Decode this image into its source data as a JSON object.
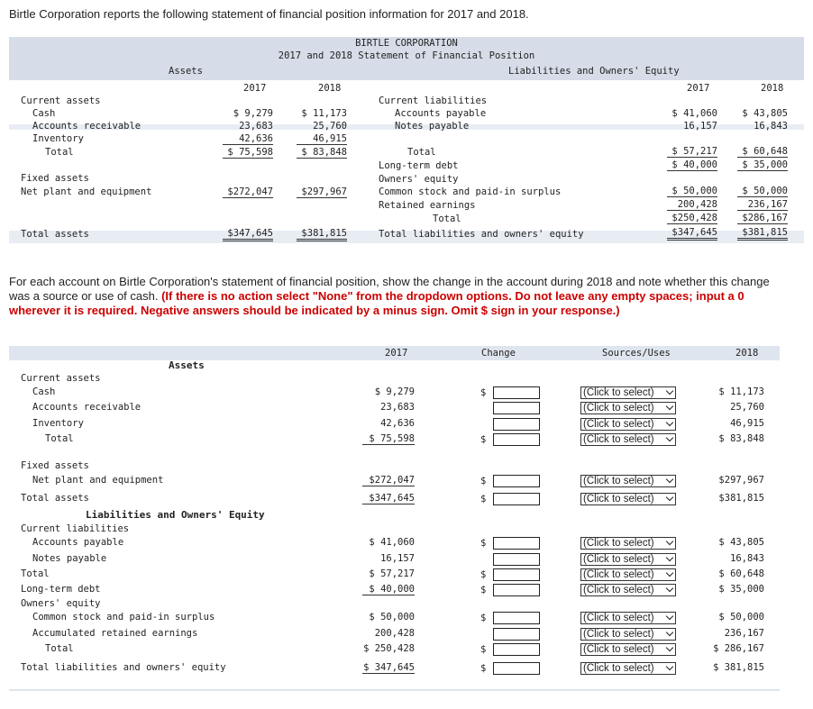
{
  "intro": "Birtle Corporation reports the following statement of financial position information for 2017 and 2018.",
  "bs": {
    "company": "BIRTLE CORPORATION",
    "subtitle": "2017 and 2018 Statement of Financial Position",
    "assets_header": "Assets",
    "le_header": "Liabilities and Owners' Equity",
    "y2017": "2017",
    "y2018": "2018",
    "left": [
      {
        "label": "Current assets",
        "a": "",
        "b": ""
      },
      {
        "label": "Cash",
        "a": "$  9,279",
        "b": "$ 11,173"
      },
      {
        "label": "Accounts receivable",
        "a": "23,683",
        "b": "25,760"
      },
      {
        "label": "Inventory",
        "a": "42,636",
        "b": "46,915"
      },
      {
        "label": "Total",
        "a": "$ 75,598",
        "b": "$ 83,848"
      },
      {
        "label": "Fixed assets",
        "a": "",
        "b": ""
      },
      {
        "label": "Net plant and equipment",
        "a": "$272,047",
        "b": "$297,967"
      },
      {
        "label": "Total assets",
        "a": "$347,645",
        "b": "$381,815"
      }
    ],
    "right": [
      {
        "label": "Current liabilities",
        "a": "",
        "b": ""
      },
      {
        "label": "Accounts payable",
        "a": "$ 41,060",
        "b": "$ 43,805"
      },
      {
        "label": "Notes payable",
        "a": "16,157",
        "b": "16,843"
      },
      {
        "label": "Total",
        "a": "$ 57,217",
        "b": "$ 60,648"
      },
      {
        "label": "Long-term debt",
        "a": "$ 40,000",
        "b": "$ 35,000"
      },
      {
        "label": "Owners' equity",
        "a": "",
        "b": ""
      },
      {
        "label": "Common stock and paid-in surplus",
        "a": "$ 50,000",
        "b": "$ 50,000"
      },
      {
        "label": "Retained earnings",
        "a": "200,428",
        "b": "236,167"
      },
      {
        "label": "Total",
        "a": "$250,428",
        "b": "$286,167"
      },
      {
        "label": "Total liabilities and owners' equity",
        "a": "$347,645",
        "b": "$381,815"
      }
    ]
  },
  "instructions": {
    "normal": "For each account on Birtle Corporation's statement of financial position, show the change in the account during 2018 and note whether this change was a source or use of cash. ",
    "bold": "(If there is no action select \"None\" from the dropdown options. Do not leave any empty spaces; input a 0 wherever it is required. Negative answers should be indicated by a minus sign. Omit $ sign in your response.)"
  },
  "worktable": {
    "headers": {
      "y2017": "2017",
      "change": "Change",
      "sources": "Sources/Uses",
      "y2018": "2018"
    },
    "assets_title": "Assets",
    "le_title": "Liabilities and Owners' Equity",
    "dollar": "$",
    "select_placeholder": "(Click to select)",
    "rows": [
      {
        "label": "Current assets",
        "v2017": "",
        "v2018": ""
      },
      {
        "label": "Cash",
        "v2017": "$  9,279",
        "v2018": "$ 11,173"
      },
      {
        "label": "Accounts receivable",
        "v2017": "23,683",
        "v2018": "25,760"
      },
      {
        "label": "Inventory",
        "v2017": "42,636",
        "v2018": "46,915"
      },
      {
        "label": "Total",
        "v2017": "$ 75,598",
        "v2018": "$ 83,848"
      },
      {
        "label": "Fixed assets",
        "v2017": "",
        "v2018": ""
      },
      {
        "label": "Net plant and equipment",
        "v2017": "$272,047",
        "v2018": "$297,967"
      },
      {
        "label": "Total assets",
        "v2017": "$347,645",
        "v2018": "$381,815"
      },
      {
        "label": "Current liabilities",
        "v2017": "",
        "v2018": ""
      },
      {
        "label": "Accounts payable",
        "v2017": "$ 41,060",
        "v2018": "$ 43,805"
      },
      {
        "label": "Notes payable",
        "v2017": "16,157",
        "v2018": "16,843"
      },
      {
        "label": "Total",
        "v2017": "$ 57,217",
        "v2018": "$ 60,648"
      },
      {
        "label": "Long-term debt",
        "v2017": "$ 40,000",
        "v2018": "$ 35,000"
      },
      {
        "label": "Owners' equity",
        "v2017": "",
        "v2018": ""
      },
      {
        "label": "Common stock and paid-in surplus",
        "v2017": "$ 50,000",
        "v2018": "$ 50,000"
      },
      {
        "label": "Accumulated retained earnings",
        "v2017": "200,428",
        "v2018": "236,167"
      },
      {
        "label": "Total",
        "v2017": "$ 250,428",
        "v2018": "$ 286,167"
      },
      {
        "label": "Total liabilities and owners' equity",
        "v2017": "$ 347,645",
        "v2018": "$ 381,815"
      }
    ]
  }
}
